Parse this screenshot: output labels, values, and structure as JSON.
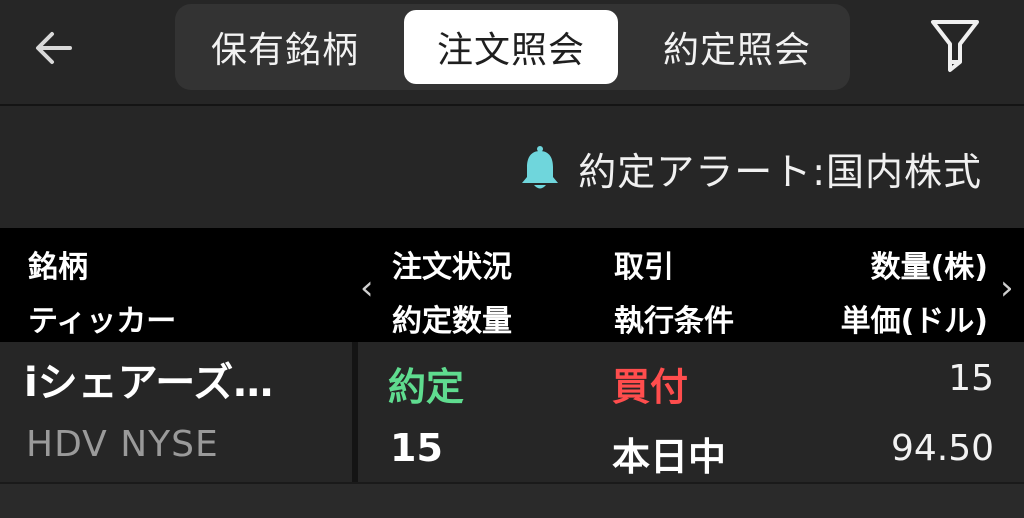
{
  "tabs": [
    {
      "label": "保有銘柄",
      "active": false
    },
    {
      "label": "注文照会",
      "active": true
    },
    {
      "label": "約定照会",
      "active": false
    }
  ],
  "icons": {
    "back": "arrow-left-icon",
    "filter": "filter-icon",
    "bell": "bell-icon"
  },
  "alert": {
    "label": "約定アラート:国内株式"
  },
  "header": {
    "col1": {
      "line1": "銘柄",
      "line2": "ティッカー"
    },
    "col2": {
      "line1": "注文状況",
      "line2": "約定数量"
    },
    "col3": {
      "line1": "取引",
      "line2": "執行条件"
    },
    "col4": {
      "line1": "数量(株)",
      "line2": "単価(ドル)"
    }
  },
  "orders": [
    {
      "name": "iシェアーズ…",
      "ticker": "HDV NYSE",
      "status": "約定",
      "filled_qty": "15",
      "side": "買付",
      "condition": "本日中",
      "quantity": "15",
      "price": "94.50"
    }
  ],
  "colors": {
    "status_filled": "#5fdc8f",
    "side_buy": "#ff4d4d",
    "bell": "#6fd6dc",
    "background": "#262626",
    "header_bg": "#000000"
  }
}
